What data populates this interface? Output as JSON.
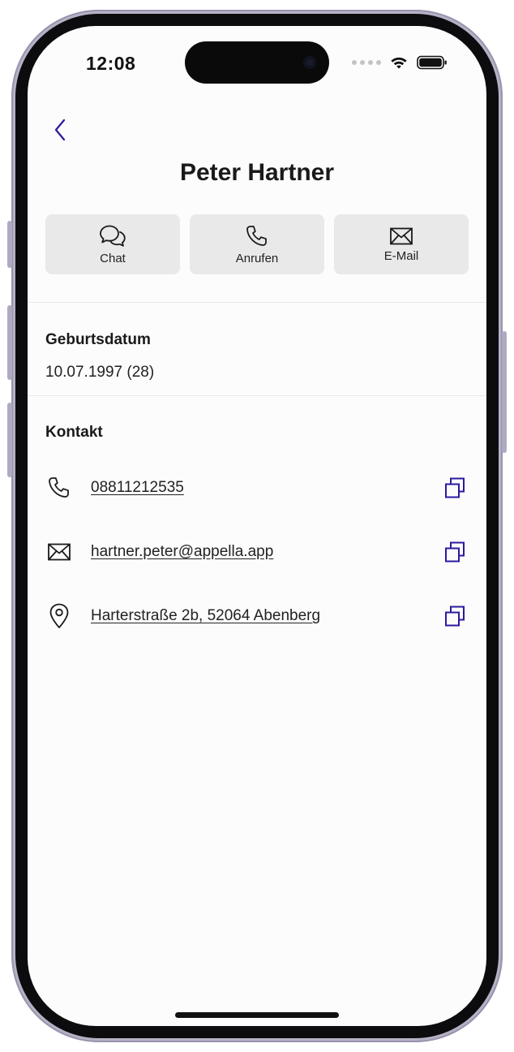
{
  "status_bar": {
    "time": "12:08"
  },
  "contact": {
    "name": "Peter Hartner"
  },
  "actions": [
    {
      "label": "Chat",
      "icon": "chat-bubbles-icon"
    },
    {
      "label": "Anrufen",
      "icon": "phone-icon"
    },
    {
      "label": "E-Mail",
      "icon": "envelope-icon"
    }
  ],
  "birthday": {
    "title": "Geburtsdatum",
    "value": "10.07.1997 (28)"
  },
  "kontakt": {
    "title": "Kontakt",
    "rows": [
      {
        "icon": "phone-icon",
        "value": "08811212535"
      },
      {
        "icon": "envelope-icon",
        "value": "hartner.peter@appella.app"
      },
      {
        "icon": "location-pin-icon",
        "value": "Harterstraße 2b, 52064 Abenberg"
      }
    ]
  },
  "colors": {
    "accent": "#2a1a9e",
    "button_bg": "#e9e9e9",
    "text": "#1a1a1a"
  }
}
